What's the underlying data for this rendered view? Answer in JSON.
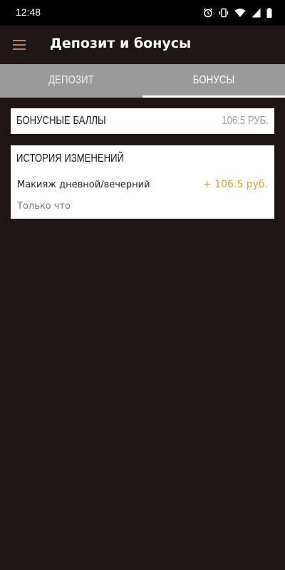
{
  "status_bar": {
    "time": "12:48",
    "icons": [
      "alarm-icon",
      "vibrate-icon",
      "wifi-icon",
      "signal-icon",
      "battery-icon"
    ]
  },
  "app_bar": {
    "title": "Депозит и бонусы",
    "menu_icon": "hamburger-menu-icon"
  },
  "tabs": [
    {
      "label": "Депозит",
      "selected": false
    },
    {
      "label": "Бонусы",
      "selected": true
    }
  ],
  "balance": {
    "label": "Бонусные баллы",
    "value": "106.5 РУБ."
  },
  "history": {
    "title": "История изменений",
    "items": [
      {
        "name": "Макияж дневной/вечерний",
        "amount": "+ 106.5 руб.",
        "time": "Только что"
      }
    ]
  },
  "colors": {
    "background": "#1e1614",
    "tab_bar": "#9a9a9a",
    "accent_menu": "#b9835f",
    "amount_positive": "#d7a235"
  }
}
